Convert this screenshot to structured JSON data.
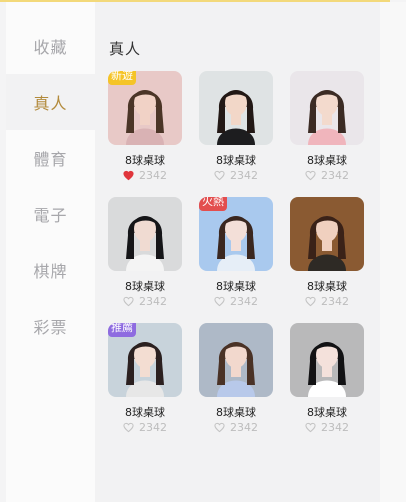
{
  "sidebar": {
    "items": [
      {
        "label": "收藏",
        "active": false
      },
      {
        "label": "真人",
        "active": true
      },
      {
        "label": "體育",
        "active": false
      },
      {
        "label": "電子",
        "active": false
      },
      {
        "label": "棋牌",
        "active": false
      },
      {
        "label": "彩票",
        "active": false
      }
    ]
  },
  "main": {
    "section_title": "真人",
    "cards": [
      {
        "name": "8球桌球",
        "likes": "2342",
        "liked": true,
        "badge": "新遊",
        "badge_type": "new",
        "bg": "#e8c9c7",
        "skin": "#f1d2c6",
        "hair": "#4b3527",
        "cloth": "#d9b2b4"
      },
      {
        "name": "8球桌球",
        "likes": "2342",
        "liked": false,
        "badge": "",
        "badge_type": "",
        "bg": "#dfe3e4",
        "skin": "#f2d7c8",
        "hair": "#221815",
        "cloth": "#1d1d1f"
      },
      {
        "name": "8球桌球",
        "likes": "2342",
        "liked": false,
        "badge": "",
        "badge_type": "",
        "bg": "#eae6ea",
        "skin": "#f3dacd",
        "hair": "#3b2b24",
        "cloth": "#f0b5bc"
      },
      {
        "name": "8球桌球",
        "likes": "2342",
        "liked": false,
        "badge": "",
        "badge_type": "",
        "bg": "#d9dadb",
        "skin": "#f0dbd2",
        "hair": "#151518",
        "cloth": "#f4f4f4"
      },
      {
        "name": "8球桌球",
        "likes": "2342",
        "liked": false,
        "badge": "火熱",
        "badge_type": "hot",
        "bg": "#a9c9ee",
        "skin": "#f3dfd8",
        "hair": "#3a2720",
        "cloth": "#e6eef7"
      },
      {
        "name": "8球桌球",
        "likes": "2342",
        "liked": false,
        "badge": "",
        "badge_type": "",
        "bg": "#8a5a32",
        "skin": "#f0d0bf",
        "hair": "#3a2218",
        "cloth": "#2e2a25"
      },
      {
        "name": "8球桌球",
        "likes": "2342",
        "liked": false,
        "badge": "推薦",
        "badge_type": "rec",
        "bg": "#c8d3db",
        "skin": "#f3ddd2",
        "hair": "#2b2020",
        "cloth": "#e7e7e7"
      },
      {
        "name": "8球桌球",
        "likes": "2342",
        "liked": false,
        "badge": "",
        "badge_type": "",
        "bg": "#aeb9c7",
        "skin": "#f2d8cd",
        "hair": "#4a3226",
        "cloth": "#b8c9ea"
      },
      {
        "name": "8球桌球",
        "likes": "2342",
        "liked": false,
        "badge": "",
        "badge_type": "",
        "bg": "#b9b9ba",
        "skin": "#f4e1db",
        "hair": "#121214",
        "cloth": "#ffffff"
      }
    ]
  }
}
